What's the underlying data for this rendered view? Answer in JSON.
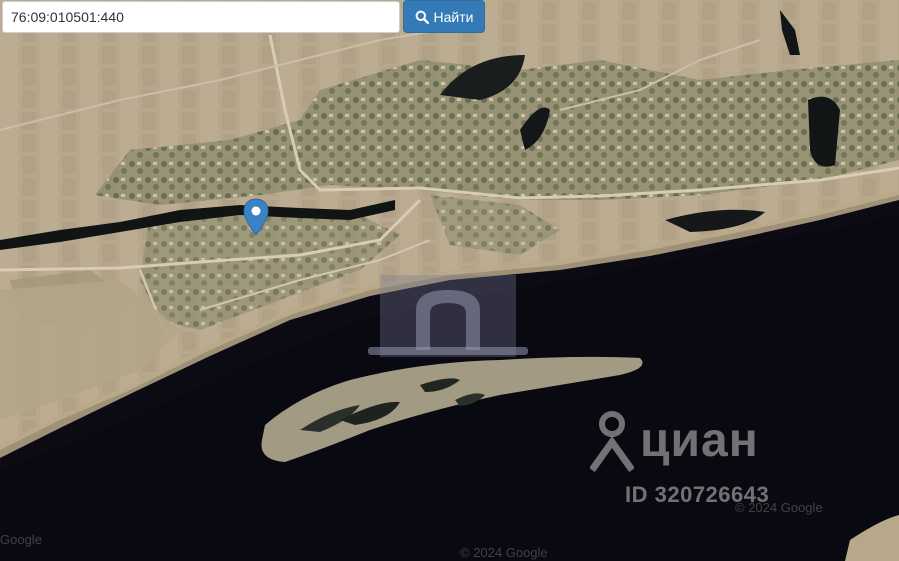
{
  "search": {
    "value": "76:09:010501:440",
    "button_label": "Найти",
    "button_icon": "search-icon"
  },
  "colors": {
    "button_bg": "#337ab7",
    "pin": "#3b82c4",
    "river": "#0c0b14",
    "land": "#b8a98e"
  },
  "watermark": {
    "brand": "циан",
    "id_text": "ID 320726643"
  },
  "attribution": {
    "google_center": "© 2024 Google",
    "google_right": "© 2024 Google",
    "google_left": "Google"
  }
}
